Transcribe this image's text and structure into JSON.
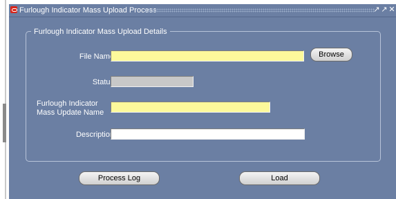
{
  "window": {
    "title": "Furlough Indicator Mass Upload Process",
    "minimize_glyph": "↗",
    "restore_glyph": "↗",
    "close_glyph": "✕"
  },
  "section": {
    "legend": "Furlough Indicator Mass Upload Details"
  },
  "fields": {
    "file_name_label": "File Name",
    "file_name_value": "",
    "status_label": "Status",
    "status_value": "",
    "mass_update_label_line1": "Furlough Indicator",
    "mass_update_label_line2": "Mass Update Name",
    "mass_update_value": "",
    "description_label": "Description",
    "description_value": ""
  },
  "buttons": {
    "browse": "Browse",
    "process_log": "Process Log",
    "load": "Load"
  },
  "colors": {
    "window_bg": "#6b7fa3",
    "required_field": "#fdf99b",
    "readonly_field": "#c8c8c8"
  },
  "icons": [
    "oracle-app-icon",
    "minimize-icon",
    "restore-icon",
    "close-icon"
  ]
}
